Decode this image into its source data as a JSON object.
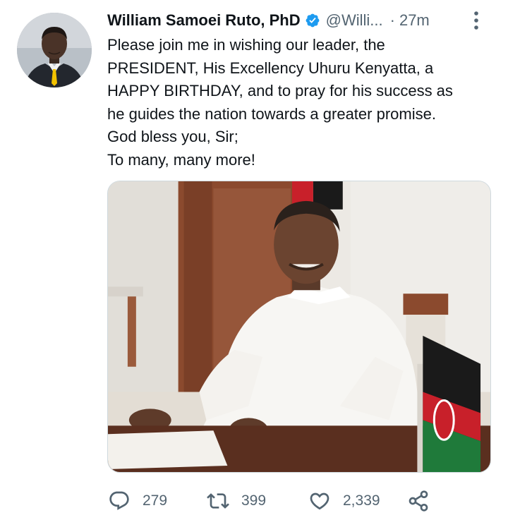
{
  "tweet": {
    "author": {
      "display_name": "William Samoei Ruto, PhD",
      "verified": true,
      "handle": "@Willi...",
      "avatar_icon": "profile-photo"
    },
    "separator": "·",
    "timestamp": "27m",
    "more_icon": "more-vertical-icon",
    "text_lines": [
      "Please join me in wishing our leader, the",
      "PRESIDENT, His Excellency Uhuru Kenyatta, a",
      "HAPPY BIRTHDAY, and to pray for his success as",
      "he guides the nation towards a greater promise.",
      "God bless you, Sir;",
      "To many, many more!"
    ],
    "media": {
      "type": "photo",
      "description_icon": "tweet-photo"
    },
    "actions": {
      "reply_count": "279",
      "retweet_count": "399",
      "like_count": "2,339"
    },
    "colors": {
      "verified_blue": "#1d9bf0",
      "secondary_text": "#536471",
      "primary_text": "#0f1419"
    }
  }
}
